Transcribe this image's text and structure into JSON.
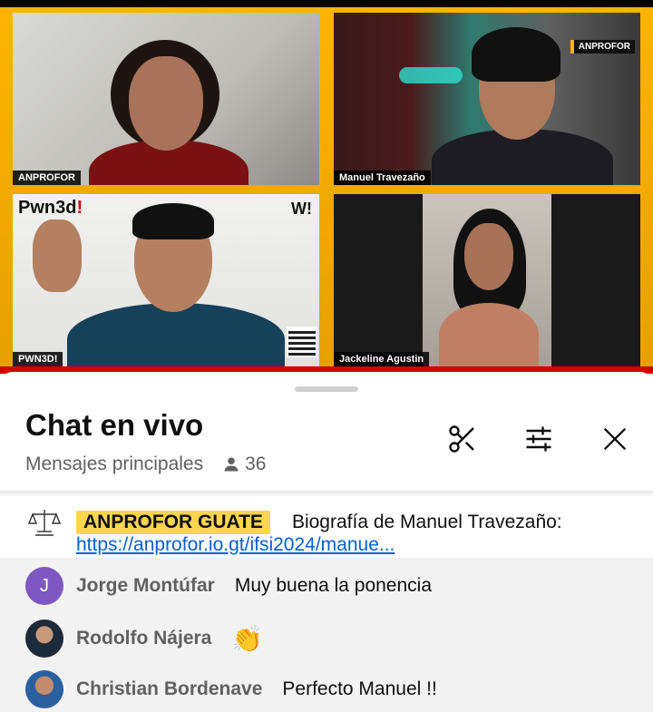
{
  "video": {
    "tiles": [
      {
        "name_tag": "ANPROFOR"
      },
      {
        "name_tag": "Manuel Travezaño",
        "brand": "ANPROFOR"
      },
      {
        "name_tag": "PWN3D!",
        "logo": "Pwn3d",
        "logo_bang": "!",
        "w_logo": "W!"
      },
      {
        "name_tag": "Jackeline Agustin"
      }
    ]
  },
  "chat": {
    "title": "Chat en vivo",
    "mode": "Mensajes principales",
    "viewer_count": "36",
    "icons": [
      "scissors-icon",
      "filter-sliders-icon",
      "close-icon"
    ]
  },
  "pinned": {
    "author": "ANPROFOR GUATE",
    "text": "Biografía de Manuel Travezaño:",
    "link": "https://anprofor.io.gt/ifsi2024/manue...",
    "avatar_icon": "scales-of-justice-icon"
  },
  "messages": [
    {
      "avatar_letter": "J",
      "author": "Jorge Montúfar",
      "text": "Muy buena la ponencia"
    },
    {
      "author": "Rodolfo Nájera",
      "text": "👏"
    },
    {
      "author": "Christian Bordenave",
      "text": "Perfecto Manuel !!"
    }
  ],
  "colors": {
    "owner_badge": "#ffd54f",
    "link": "#065fd4",
    "avatar_j": "#7e57c2",
    "broadcast_bg": "#ffb400",
    "broadcast_red": "#d10000"
  }
}
